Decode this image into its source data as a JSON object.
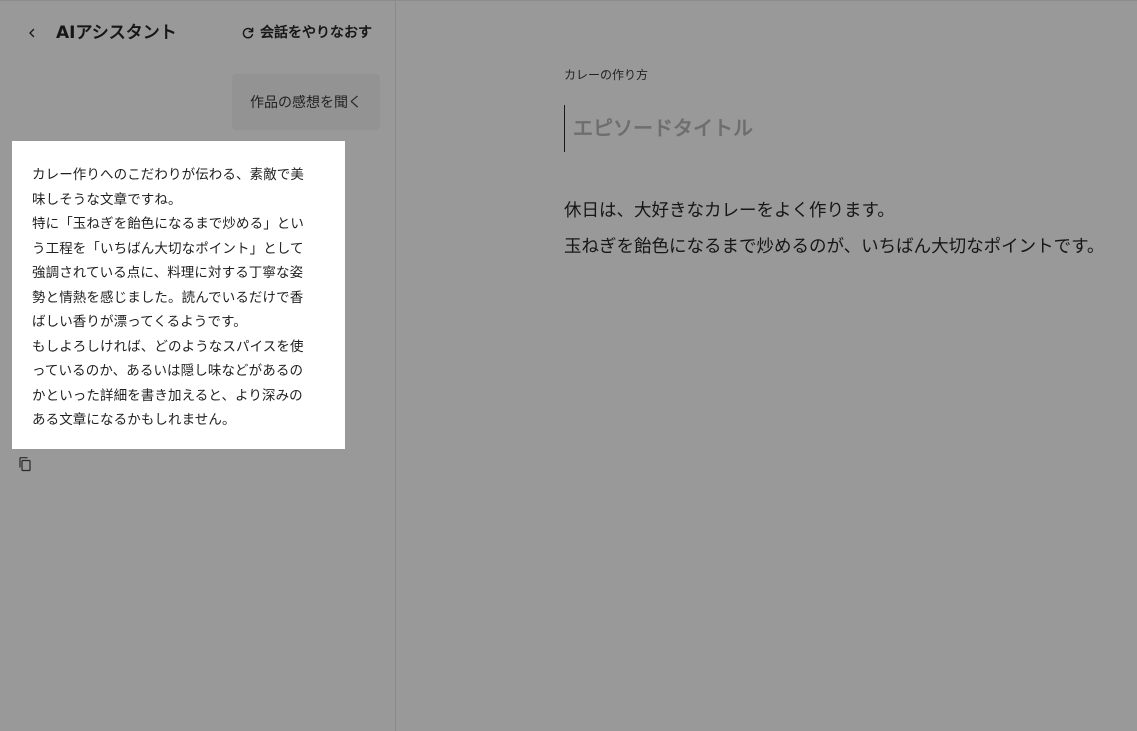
{
  "sidebar": {
    "title": "AIアシスタント",
    "restart_label": "会話をやりなおす",
    "user_message": "作品の感想を聞く",
    "ai_message_lines": [
      "カレー作りへのこだわりが伝わる、素敵で美",
      "味しそうな文章ですね。",
      "特に「玉ねぎを飴色になるまで炒める」とい",
      "う工程を「いちばん大切なポイント」として",
      "強調されている点に、料理に対する丁寧な姿",
      "勢と情熱を感じました。読んでいるだけで香",
      "ばしい香りが漂ってくるようです。",
      "もしよろしければ、どのようなスパイスを使",
      "っているのか、あるいは隠し味などがあるの",
      "かといった詳細を書き加えると、より深みの",
      "ある文章になるかもしれません。"
    ]
  },
  "editor": {
    "work_title": "カレーの作り方",
    "episode_title_placeholder": "エピソードタイトル",
    "body_lines": [
      "休日は、大好きなカレーをよく作ります。",
      "玉ねぎを飴色になるまで炒めるのが、いちばん大切なポイントです。"
    ]
  },
  "icons": {
    "back": "chevron-left-icon",
    "restart": "refresh-icon",
    "copy": "copy-icon"
  },
  "colors": {
    "background": "#999999",
    "ai_bubble": "#ffffff",
    "user_bubble": "#939393",
    "text": "#161616",
    "placeholder": "#6e6e6e"
  }
}
